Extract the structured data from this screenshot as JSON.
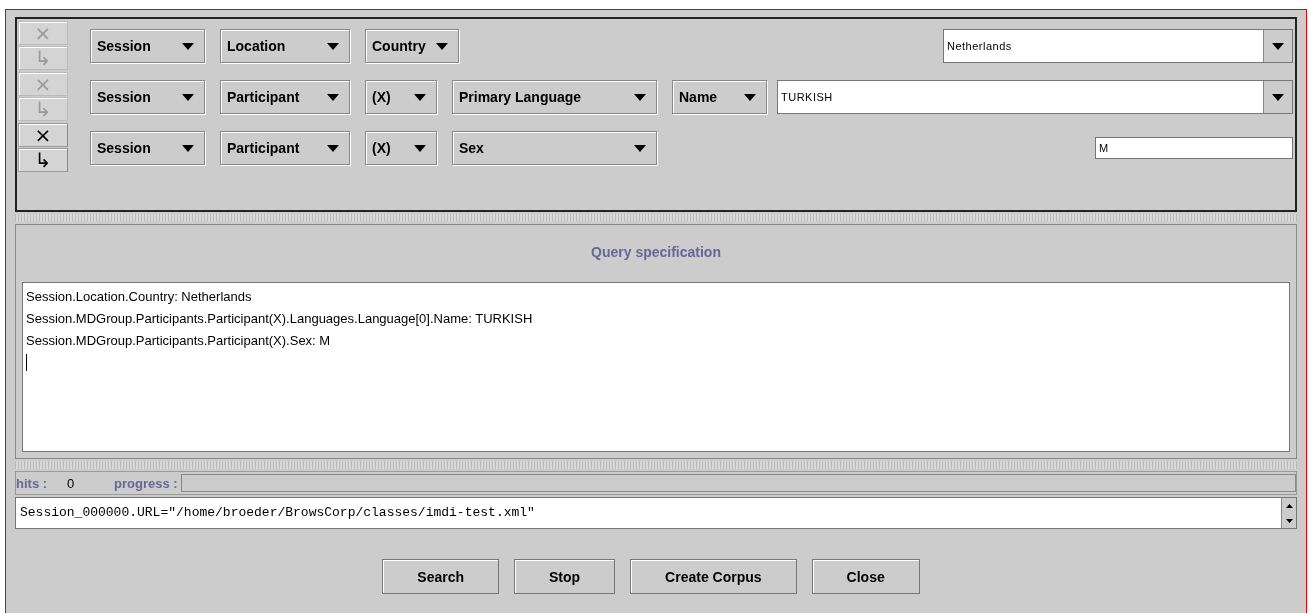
{
  "criteria": [
    {
      "remove": {
        "label": "×",
        "disabled": true
      },
      "add": {
        "label": "↳",
        "disabled": true
      },
      "selects": [
        "Session",
        "Location",
        "Country"
      ],
      "value": {
        "kind": "combo",
        "value": "Netherlands"
      }
    },
    {
      "remove": {
        "label": "×",
        "disabled": true
      },
      "add": {
        "label": "↳",
        "disabled": true
      },
      "selects": [
        "Session",
        "Participant",
        "(X)",
        "Primary Language",
        "Name"
      ],
      "value": {
        "kind": "combo",
        "value": "TURKISH"
      }
    },
    {
      "remove": {
        "label": "×",
        "disabled": false
      },
      "add": {
        "label": "↳",
        "disabled": false
      },
      "selects": [
        "Session",
        "Participant",
        "(X)",
        "Sex"
      ],
      "value": {
        "kind": "text",
        "value": "M"
      }
    }
  ],
  "query": {
    "title": "Query specification",
    "lines": [
      "Session.Location.Country: Netherlands",
      "Session.MDGroup.Participants.Participant(X).Languages.Language[0].Name: TURKISH",
      "Session.MDGroup.Participants.Participant(X).Sex: M"
    ]
  },
  "status": {
    "hits_label": "hits :",
    "hits": "0",
    "progress_label": "progress :",
    "progress": {
      "level": 0
    }
  },
  "result": "Session_000000.URL=\"/home/broeder/BrowsCorp/classes/imdi-test.xml\"",
  "buttons": [
    "Search",
    "Stop",
    "Create Corpus",
    "Close"
  ]
}
